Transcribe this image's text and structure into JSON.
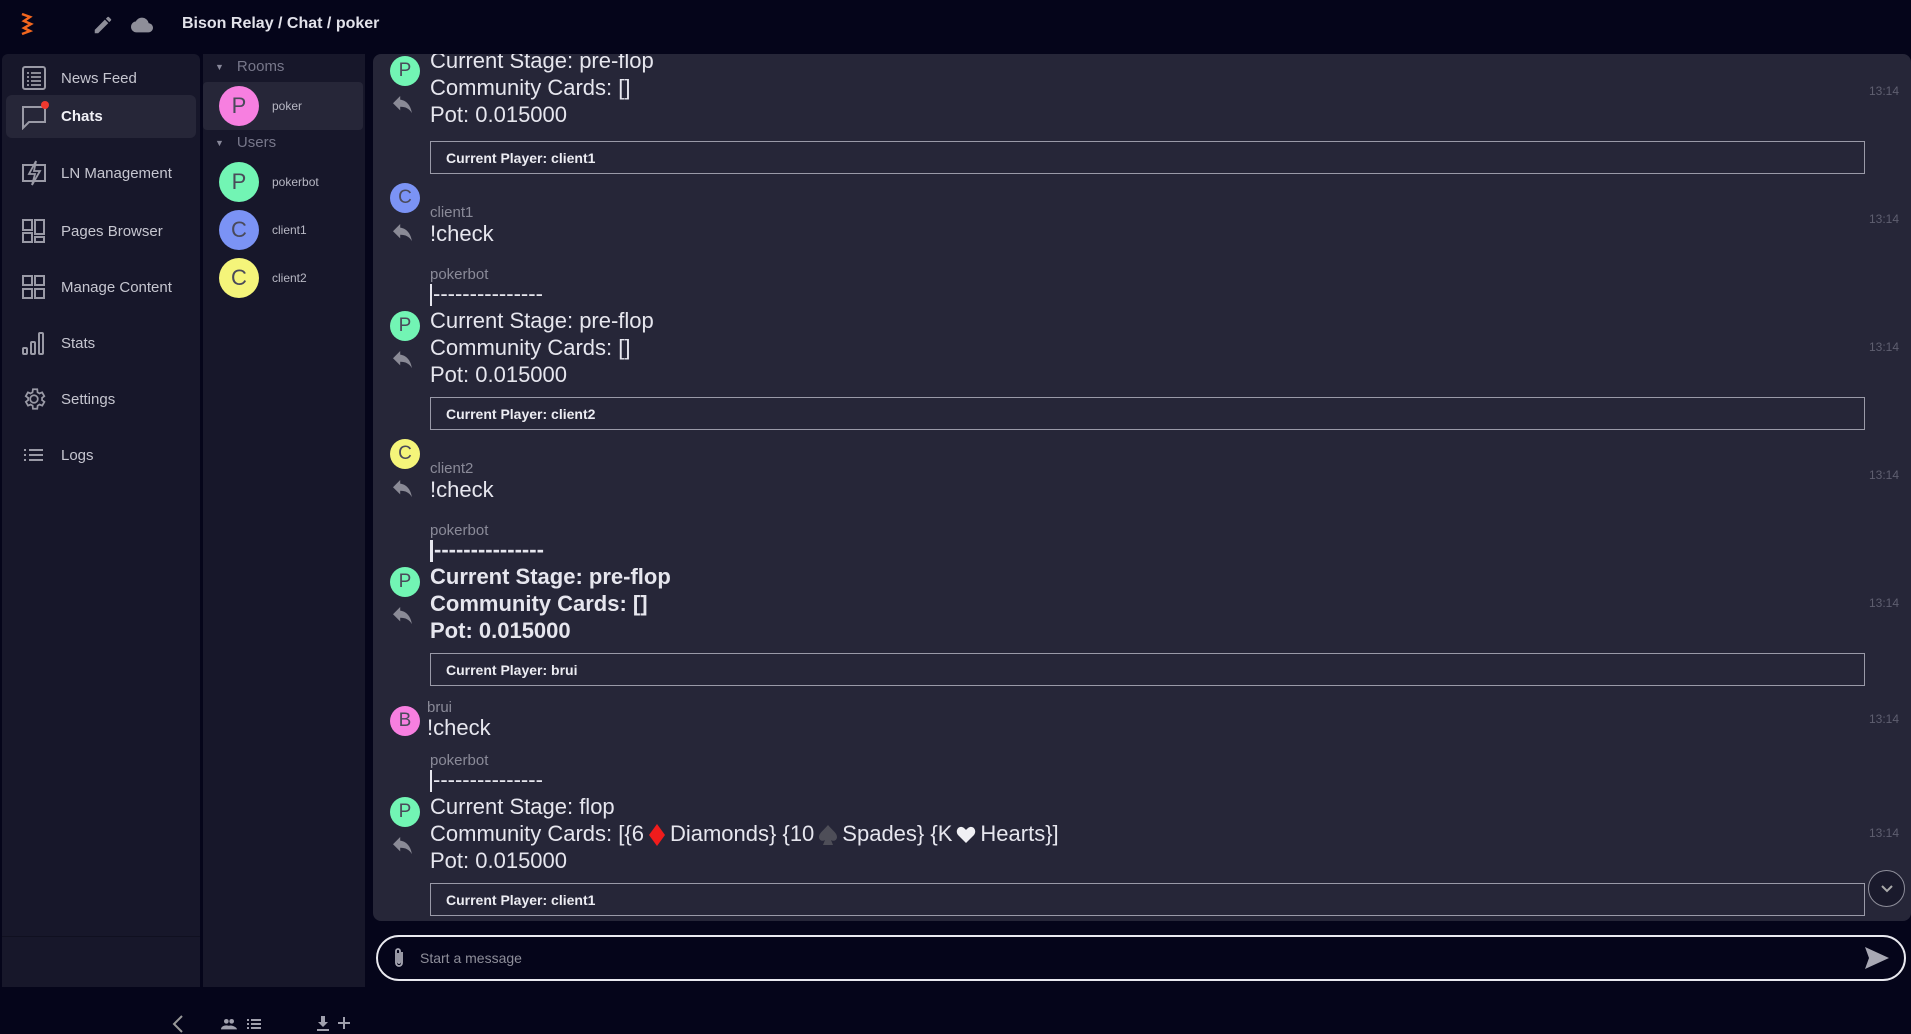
{
  "header": {
    "title": "Bison Relay / Chat / poker"
  },
  "nav": {
    "items": [
      {
        "label": "News Feed",
        "icon": "news-feed-icon"
      },
      {
        "label": "Chats",
        "icon": "chat-icon",
        "active": true,
        "badge": true
      },
      {
        "label": "LN Management",
        "icon": "lightning-icon"
      },
      {
        "label": "Pages Browser",
        "icon": "pages-icon"
      },
      {
        "label": "Manage Content",
        "icon": "grid-icon"
      },
      {
        "label": "Stats",
        "icon": "stats-icon"
      },
      {
        "label": "Settings",
        "icon": "gear-icon"
      },
      {
        "label": "Logs",
        "icon": "list-icon"
      }
    ]
  },
  "rooms": {
    "rooms_header": "Rooms",
    "users_header": "Users",
    "rooms": [
      {
        "name": "poker",
        "initial": "P",
        "color": "#f77fe0"
      }
    ],
    "users": [
      {
        "name": "pokerbot",
        "initial": "P",
        "color": "#72f5b4"
      },
      {
        "name": "client1",
        "initial": "C",
        "color": "#7b93f5"
      },
      {
        "name": "client2",
        "initial": "C",
        "color": "#f5f57a"
      }
    ]
  },
  "messages": [
    {
      "nick": "",
      "initial": "P",
      "color": "#72f5b4",
      "lines": [
        "Current Stage: pre-flop",
        "Community Cards: []",
        "Pot: 0.015000"
      ],
      "player": "Current Player: client1",
      "time": "13:14"
    },
    {
      "nick": "client1",
      "initial": "C",
      "color": "#7b93f5",
      "text": "!check",
      "time": "13:14"
    },
    {
      "nick": "pokerbot",
      "initial": "P",
      "color": "#72f5b4",
      "separator": "---------------",
      "lines": [
        "Current Stage: pre-flop",
        "Community Cards: []",
        "Pot: 0.015000"
      ],
      "player": "Current Player: client2",
      "time": "13:14"
    },
    {
      "nick": "client2",
      "initial": "C",
      "color": "#f5f57a",
      "text": "!check",
      "time": "13:14"
    },
    {
      "nick": "pokerbot",
      "initial": "P",
      "color": "#72f5b4",
      "separator": "---------------",
      "lines": [
        "Current Stage: pre-flop",
        "Community Cards: []",
        "Pot: 0.015000"
      ],
      "player": "Current Player: brui",
      "time": "13:14",
      "bold": true
    },
    {
      "nick": "brui",
      "initial": "B",
      "color": "#f77fe0",
      "text": "!check",
      "time": "13:14"
    },
    {
      "nick": "pokerbot",
      "initial": "P",
      "color": "#72f5b4",
      "separator": "---------------",
      "stage": "Current Stage: flop",
      "cards": {
        "prefix": "Community Cards: [{6",
        "d_label": "Diamonds} {10",
        "s_label": "Spades} {K",
        "h_label": "Hearts}]"
      },
      "pot": "Pot: 0.015000",
      "player": "Current Player: client1",
      "time": "13:14"
    }
  ],
  "compose": {
    "placeholder": "Start a message"
  }
}
